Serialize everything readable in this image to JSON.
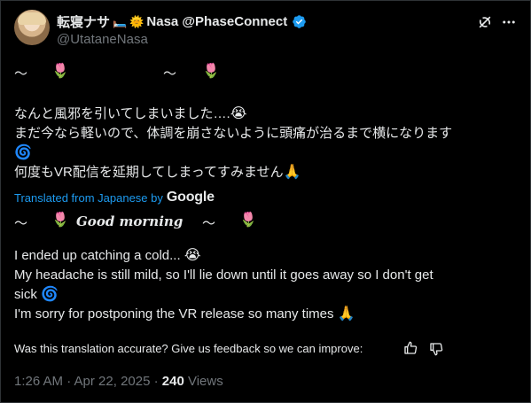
{
  "tweet": {
    "display_name": "転寝ナサ",
    "display_name_suffix": "Nasa @PhaseConnect",
    "handle": "@UtataneNasa",
    "deco_symbol": "〜",
    "tulip": "🌷",
    "japanese_lines": [
      "なんと風邪を引いてしまいました….",
      "まだ今なら軽いので、体調を崩さないように頭痛が治るまで横になります",
      "何度もVR配信を延期してしまってすみません"
    ],
    "translated_label": "Translated from Japanese by",
    "translator": "Google",
    "good_morning": "Good morning",
    "english_lines": [
      "I ended up catching a cold...",
      "My headache is still mild, so I'll lie down until it goes away so I don't get",
      "sick",
      "I'm sorry for postponing the VR release so many times"
    ],
    "emojis": {
      "cry": "😭",
      "dizzy": "🌀",
      "pray": "🙏",
      "bed": "🛏️",
      "sun": "🌞"
    },
    "feedback_prompt": "Was this translation accurate? Give us feedback so we can improve:",
    "timestamp": "1:26 AM · Apr 22, 2025 · ",
    "views_count": "240",
    "views_label": " Views"
  },
  "colors": {
    "background": "#000000",
    "text": "#e7e9ea",
    "secondary": "#71767b",
    "link": "#1d9bf0",
    "verified": "#1d9bf0"
  },
  "icons": [
    "grok-icon",
    "more-icon",
    "verified-badge-icon",
    "thumbs-up-icon",
    "thumbs-down-icon"
  ]
}
